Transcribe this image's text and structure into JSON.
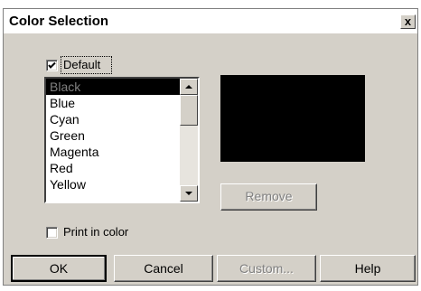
{
  "dialog": {
    "title": "Color Selection",
    "close_label": "x"
  },
  "default_checkbox": {
    "label": "Default",
    "checked": true
  },
  "color_list": {
    "items": [
      "Black",
      "Blue",
      "Cyan",
      "Green",
      "Magenta",
      "Red",
      "Yellow"
    ],
    "selected": "Black"
  },
  "preview": {
    "color": "#000000"
  },
  "remove_button": {
    "label": "Remove",
    "enabled": false
  },
  "print_checkbox": {
    "label": "Print in color",
    "checked": false
  },
  "buttons": {
    "ok": "OK",
    "cancel": "Cancel",
    "custom": "Custom...",
    "help": "Help"
  }
}
